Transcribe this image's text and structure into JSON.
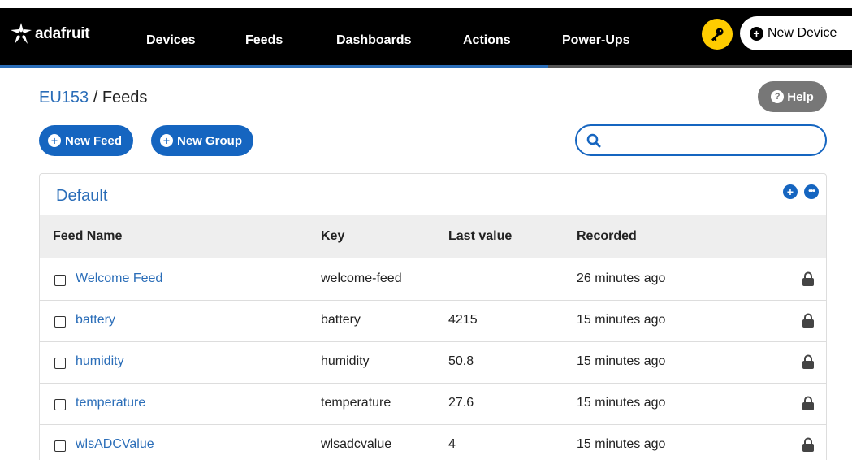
{
  "header": {
    "logo_text": "adafruit",
    "nav": [
      "Devices",
      "Feeds",
      "Dashboards",
      "Actions",
      "Power-Ups"
    ],
    "key_icon": "key-icon",
    "new_device_label": "New Device"
  },
  "breadcrumb": {
    "user": "EU153",
    "separator": " / ",
    "page": "Feeds"
  },
  "help_label": "Help",
  "actions": {
    "new_feed_label": "New Feed",
    "new_group_label": "New Group",
    "search_placeholder": ""
  },
  "group": {
    "title": "Default",
    "columns": [
      "Feed Name",
      "Key",
      "Last value",
      "Recorded"
    ],
    "feeds": [
      {
        "name": "Welcome Feed",
        "key": "welcome-feed",
        "last_value": "",
        "recorded": "26 minutes ago"
      },
      {
        "name": "battery",
        "key": "battery",
        "last_value": "4215",
        "recorded": "15 minutes ago"
      },
      {
        "name": "humidity",
        "key": "humidity",
        "last_value": "50.8",
        "recorded": "15 minutes ago"
      },
      {
        "name": "temperature",
        "key": "temperature",
        "last_value": "27.6",
        "recorded": "15 minutes ago"
      },
      {
        "name": "wlsADCValue",
        "key": "wlsadcvalue",
        "last_value": "4",
        "recorded": "15 minutes ago"
      }
    ]
  },
  "colors": {
    "accent": "#1565c0",
    "link": "#2a6db8",
    "topbar": "#000000",
    "key_button": "#ffcc00"
  }
}
